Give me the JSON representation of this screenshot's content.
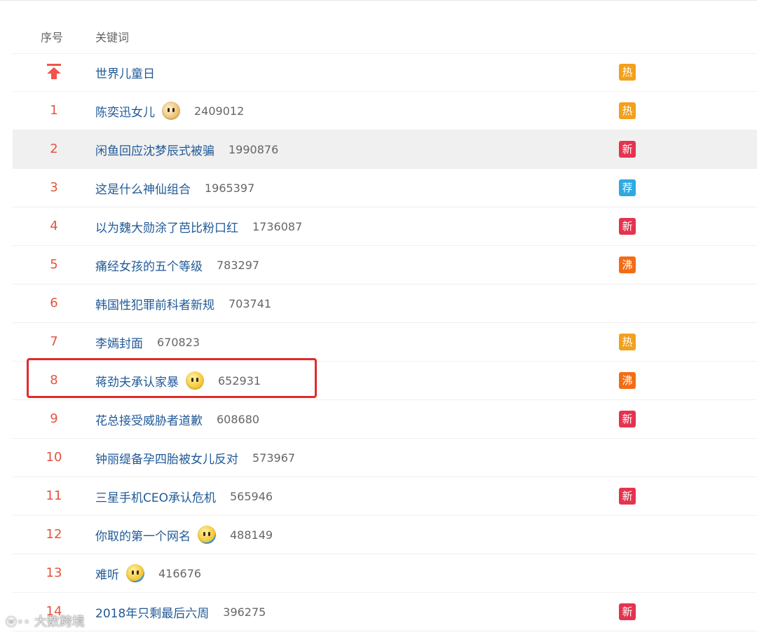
{
  "header": {
    "index_label": "序号",
    "keyword_label": "关键词"
  },
  "rows": [
    {
      "index": "",
      "pinned": true,
      "keyword": "世界儿童日",
      "count": "",
      "emoji": "",
      "badge": "热",
      "badge_color": "#f3a01b"
    },
    {
      "index": "1",
      "keyword": "陈奕迅女儿",
      "count": "2409012",
      "emoji": "dog-face-icon",
      "badge": "热",
      "badge_color": "#f3a01b"
    },
    {
      "index": "2",
      "keyword": "闲鱼回应沈梦辰式被骗",
      "count": "1990876",
      "emoji": "",
      "badge": "新",
      "badge_color": "#e5334f",
      "highlight": true
    },
    {
      "index": "3",
      "keyword": "这是什么神仙组合",
      "count": "1965397",
      "emoji": "",
      "badge": "荐",
      "badge_color": "#2fa9e0"
    },
    {
      "index": "4",
      "keyword": "以为魏大勋涂了芭比粉口红",
      "count": "1736087",
      "emoji": "",
      "badge": "新",
      "badge_color": "#e5334f"
    },
    {
      "index": "5",
      "keyword": "痛经女孩的五个等级",
      "count": "783297",
      "emoji": "",
      "badge": "沸",
      "badge_color": "#f36c15"
    },
    {
      "index": "6",
      "keyword": "韩国性犯罪前科者新规",
      "count": "703741",
      "emoji": "",
      "badge": "",
      "badge_color": ""
    },
    {
      "index": "7",
      "keyword": "李嫣封面",
      "count": "670823",
      "emoji": "",
      "badge": "热",
      "badge_color": "#f3a01b"
    },
    {
      "index": "8",
      "keyword": "蒋劲夫承认家暴",
      "count": "652931",
      "emoji": "smile-face-icon",
      "badge": "沸",
      "badge_color": "#f36c15"
    },
    {
      "index": "9",
      "keyword": "花总接受威胁者道歉",
      "count": "608680",
      "emoji": "",
      "badge": "新",
      "badge_color": "#e5334f"
    },
    {
      "index": "10",
      "keyword": "钟丽缇备孕四胎被女儿反对",
      "count": "573967",
      "emoji": "",
      "badge": "",
      "badge_color": ""
    },
    {
      "index": "11",
      "keyword": "三星手机CEO承认危机",
      "count": "565946",
      "emoji": "",
      "badge": "新",
      "badge_color": "#e5334f"
    },
    {
      "index": "12",
      "keyword": "你取的第一个网名",
      "count": "488149",
      "emoji": "laughing-tears-icon",
      "badge": "",
      "badge_color": ""
    },
    {
      "index": "13",
      "keyword": "难听",
      "count": "416676",
      "emoji": "laughing-tears-icon",
      "badge": "",
      "badge_color": ""
    },
    {
      "index": "14",
      "keyword": "2018年只剩最后六周",
      "count": "396275",
      "emoji": "",
      "badge": "新",
      "badge_color": "#e5334f"
    }
  ],
  "watermark": {
    "text": "大数跨境",
    "logo": "weibo-logo-icon"
  }
}
